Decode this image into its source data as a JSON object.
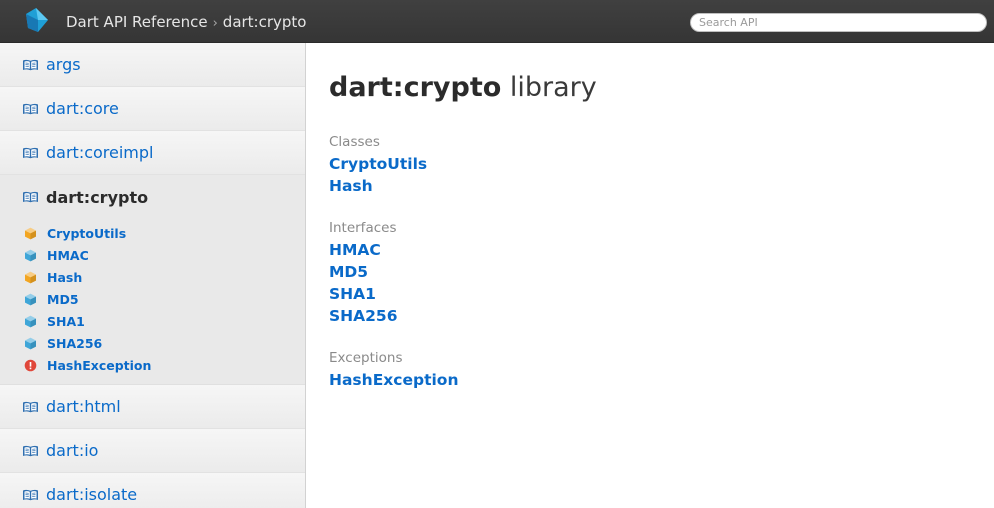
{
  "header": {
    "breadcrumb_root": "Dart API Reference",
    "breadcrumb_separator": "›",
    "breadcrumb_current": "dart:crypto",
    "search_placeholder": "Search API"
  },
  "sidebar": {
    "libraries_before": [
      {
        "name": "args"
      },
      {
        "name": "dart:core"
      },
      {
        "name": "dart:coreimpl"
      }
    ],
    "selected_library": {
      "name": "dart:crypto",
      "types": [
        {
          "name": "CryptoUtils",
          "kind": "class",
          "icon": "class-icon"
        },
        {
          "name": "HMAC",
          "kind": "interface",
          "icon": "interface-icon"
        },
        {
          "name": "Hash",
          "kind": "class",
          "icon": "class-icon"
        },
        {
          "name": "MD5",
          "kind": "interface",
          "icon": "interface-icon"
        },
        {
          "name": "SHA1",
          "kind": "interface",
          "icon": "interface-icon"
        },
        {
          "name": "SHA256",
          "kind": "interface",
          "icon": "interface-icon"
        },
        {
          "name": "HashException",
          "kind": "exception",
          "icon": "exception-icon"
        }
      ]
    },
    "libraries_after": [
      {
        "name": "dart:html"
      },
      {
        "name": "dart:io"
      },
      {
        "name": "dart:isolate"
      }
    ]
  },
  "main": {
    "title_name": "dart:crypto",
    "title_suffix": "library",
    "sections": [
      {
        "heading": "Classes",
        "items": [
          "CryptoUtils",
          "Hash"
        ]
      },
      {
        "heading": "Interfaces",
        "items": [
          "HMAC",
          "MD5",
          "SHA1",
          "SHA256"
        ]
      },
      {
        "heading": "Exceptions",
        "items": [
          "HashException"
        ]
      }
    ]
  },
  "colors": {
    "header_bg": "#3a3a3a",
    "link": "#0a6ac9",
    "class_icon": "#f2a521",
    "interface_icon": "#3fa6d8",
    "exception_icon": "#e0473a",
    "logo": "#3fb6e8"
  }
}
